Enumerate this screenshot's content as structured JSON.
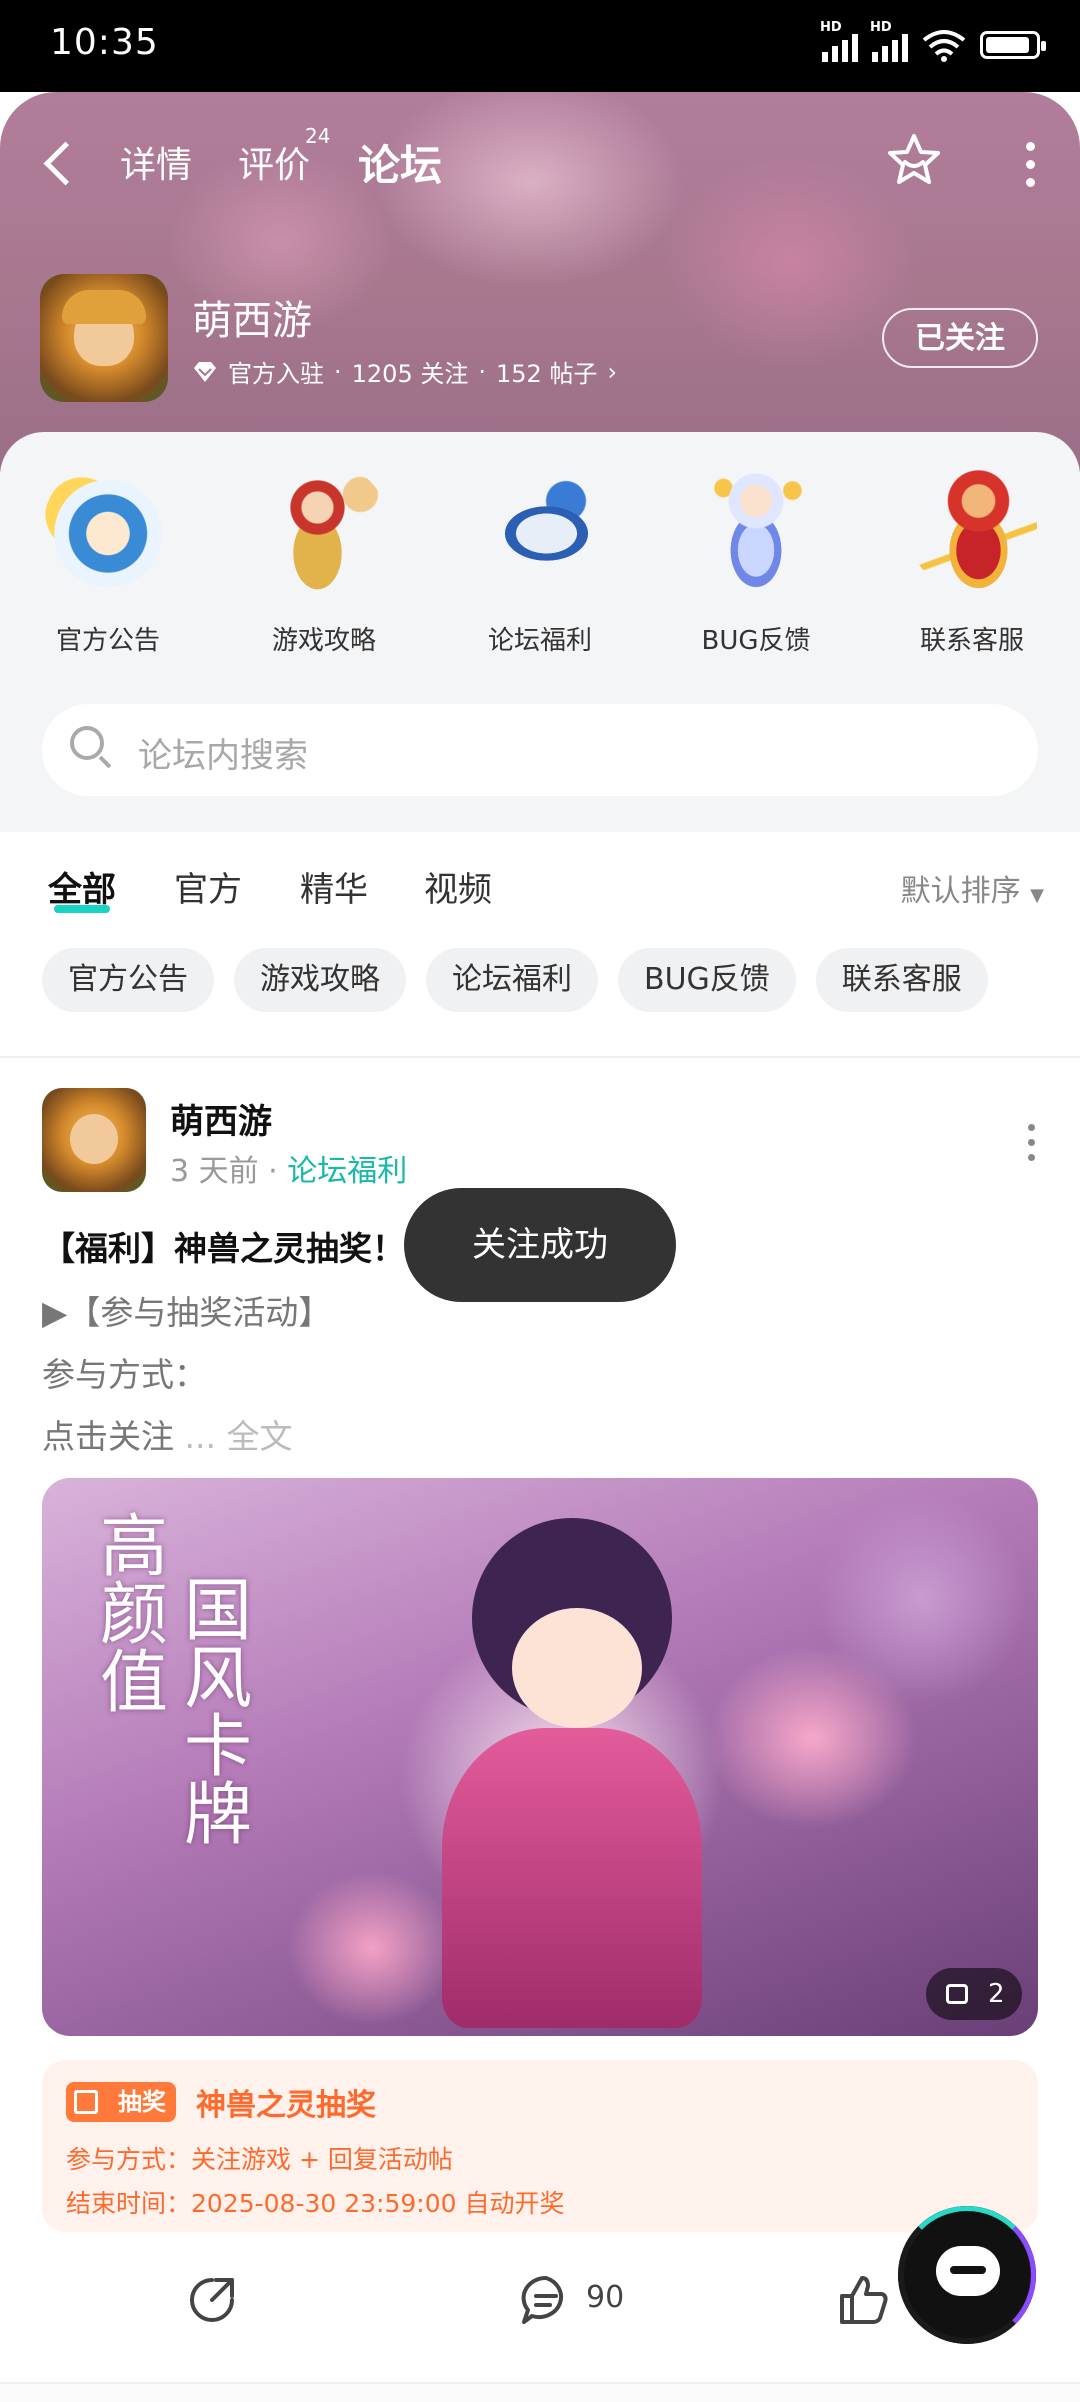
{
  "status_bar": {
    "time": "10:35",
    "hd1": "HD",
    "hd2": "HD",
    "wifi_num": "6"
  },
  "nav": {
    "tabs": [
      "详情",
      "评价",
      "论坛"
    ],
    "active": "论坛",
    "review_count": "24"
  },
  "game": {
    "name": "萌西游",
    "meta_official": "官方入驻",
    "meta_follows": "1205 关注",
    "meta_posts": "152 帖子",
    "follow_label": "已关注"
  },
  "categories": [
    {
      "label": "官方公告"
    },
    {
      "label": "游戏攻略"
    },
    {
      "label": "论坛福利"
    },
    {
      "label": "BUG反馈"
    },
    {
      "label": "联系客服"
    }
  ],
  "search": {
    "placeholder": "论坛内搜索"
  },
  "feed_tabs": [
    "全部",
    "官方",
    "精华",
    "视频"
  ],
  "sort_label": "默认排序",
  "chips": [
    "官方公告",
    "游戏攻略",
    "论坛福利",
    "BUG反馈",
    "联系客服"
  ],
  "post": {
    "author": "萌西游",
    "time": "3 天前",
    "category": "论坛福利",
    "title": "【福利】神兽之灵抽奖！",
    "line1": "▶【参与抽奖活动】",
    "line2": "参与方式：",
    "line3": "点击关注",
    "more": "... 全文",
    "banner_text_left": "高颜值",
    "banner_text_right": "国风卡牌",
    "image_count": "2",
    "lottery": {
      "tag": "抽奖",
      "title": "神兽之灵抽奖",
      "method": "参与方式：关注游戏 + 回复活动帖",
      "end": "结束时间：2025-08-30 23:59:00 自动开奖"
    },
    "comments": "90"
  },
  "toast": "关注成功",
  "colors": {
    "accent": "#19d3c5",
    "lottery": "#ff6a2c",
    "header": "#a8788f"
  }
}
